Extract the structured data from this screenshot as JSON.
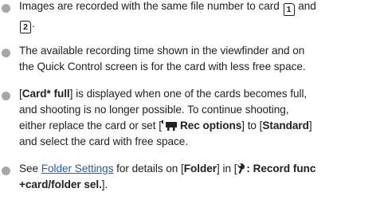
{
  "notes": [
    {
      "line1_pre": "Images are recorded with the same file number to card ",
      "card1": "1",
      "between": " and",
      "card2": "2",
      "line2_post": "."
    },
    {
      "line1": "The available recording time shown in the viewfinder and on",
      "line2": "the Quick Control screen is for the card with less free space."
    },
    {
      "l1_a": "[",
      "l1_bold": "Card* full",
      "l1_b": "] is displayed when one of the cards becomes full,",
      "l2": "and shooting is no longer possible. To continue shooting,",
      "l3_a": "either replace the card or set [",
      "l3_bold": "Rec options",
      "l3_b": "] to [",
      "l3_bold2": "Standard",
      "l3_c": "]",
      "l4": "and select the card with free space."
    },
    {
      "l1_a": "See ",
      "l1_link": "Folder Settings",
      "l1_b": " for details on [",
      "l1_bold": "Folder",
      "l1_c": "] in [",
      "l1_bold2": ": Record func",
      "l2_bold": "+card/folder sel.",
      "l2_end": "]."
    }
  ]
}
